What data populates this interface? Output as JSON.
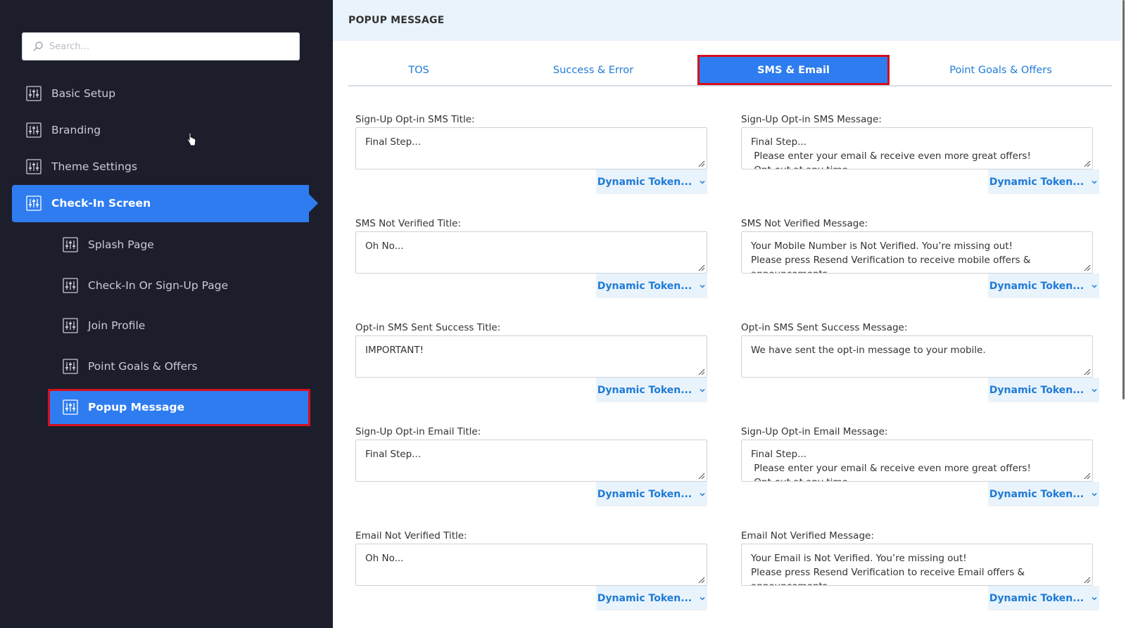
{
  "search": {
    "placeholder": "Search..."
  },
  "sidebar": {
    "items": [
      {
        "label": "Basic Setup"
      },
      {
        "label": "Branding"
      },
      {
        "label": "Theme Settings"
      },
      {
        "label": "Check-In Screen"
      }
    ],
    "subitems": [
      {
        "label": "Splash Page"
      },
      {
        "label": "Check-In Or Sign-Up Page"
      },
      {
        "label": "Join Profile"
      },
      {
        "label": "Point Goals & Offers"
      },
      {
        "label": "Popup Message"
      }
    ]
  },
  "header": {
    "title": "POPUP MESSAGE"
  },
  "tabs": [
    {
      "label": "TOS"
    },
    {
      "label": "Success & Error"
    },
    {
      "label": "SMS & Email"
    },
    {
      "label": "Point Goals & Offers"
    }
  ],
  "token_label": "Dynamic Token...",
  "fields": {
    "left": [
      {
        "label": "Sign-Up Opt-in SMS Title:",
        "value": "Final Step..."
      },
      {
        "label": "SMS Not Verified Title:",
        "value": "Oh No..."
      },
      {
        "label": "Opt-in SMS Sent Success Title:",
        "value": "IMPORTANT!"
      },
      {
        "label": "Sign-Up Opt-in Email Title:",
        "value": "Final Step..."
      },
      {
        "label": "Email Not Verified Title:",
        "value": "Oh No..."
      }
    ],
    "right": [
      {
        "label": "Sign-Up Opt-in SMS Message:",
        "value": "Final Step...\n Please enter your email & receive even more great offers!\n Opt-out at any time"
      },
      {
        "label": "SMS Not Verified Message:",
        "value": "Your Mobile Number is Not Verified. You’re missing out!\nPlease press Resend Verification to receive mobile offers &\nannouncements"
      },
      {
        "label": "Opt-in SMS Sent Success Message:",
        "value": "We have sent the opt-in message to your mobile."
      },
      {
        "label": "Sign-Up Opt-in Email Message:",
        "value": "Final Step...\n Please enter your email & receive even more great offers!\n Opt-out at any time"
      },
      {
        "label": "Email Not Verified Message:",
        "value": "Your Email is Not Verified. You’re missing out!\nPlease press Resend Verification to receive Email offers &\nannouncements"
      }
    ]
  }
}
